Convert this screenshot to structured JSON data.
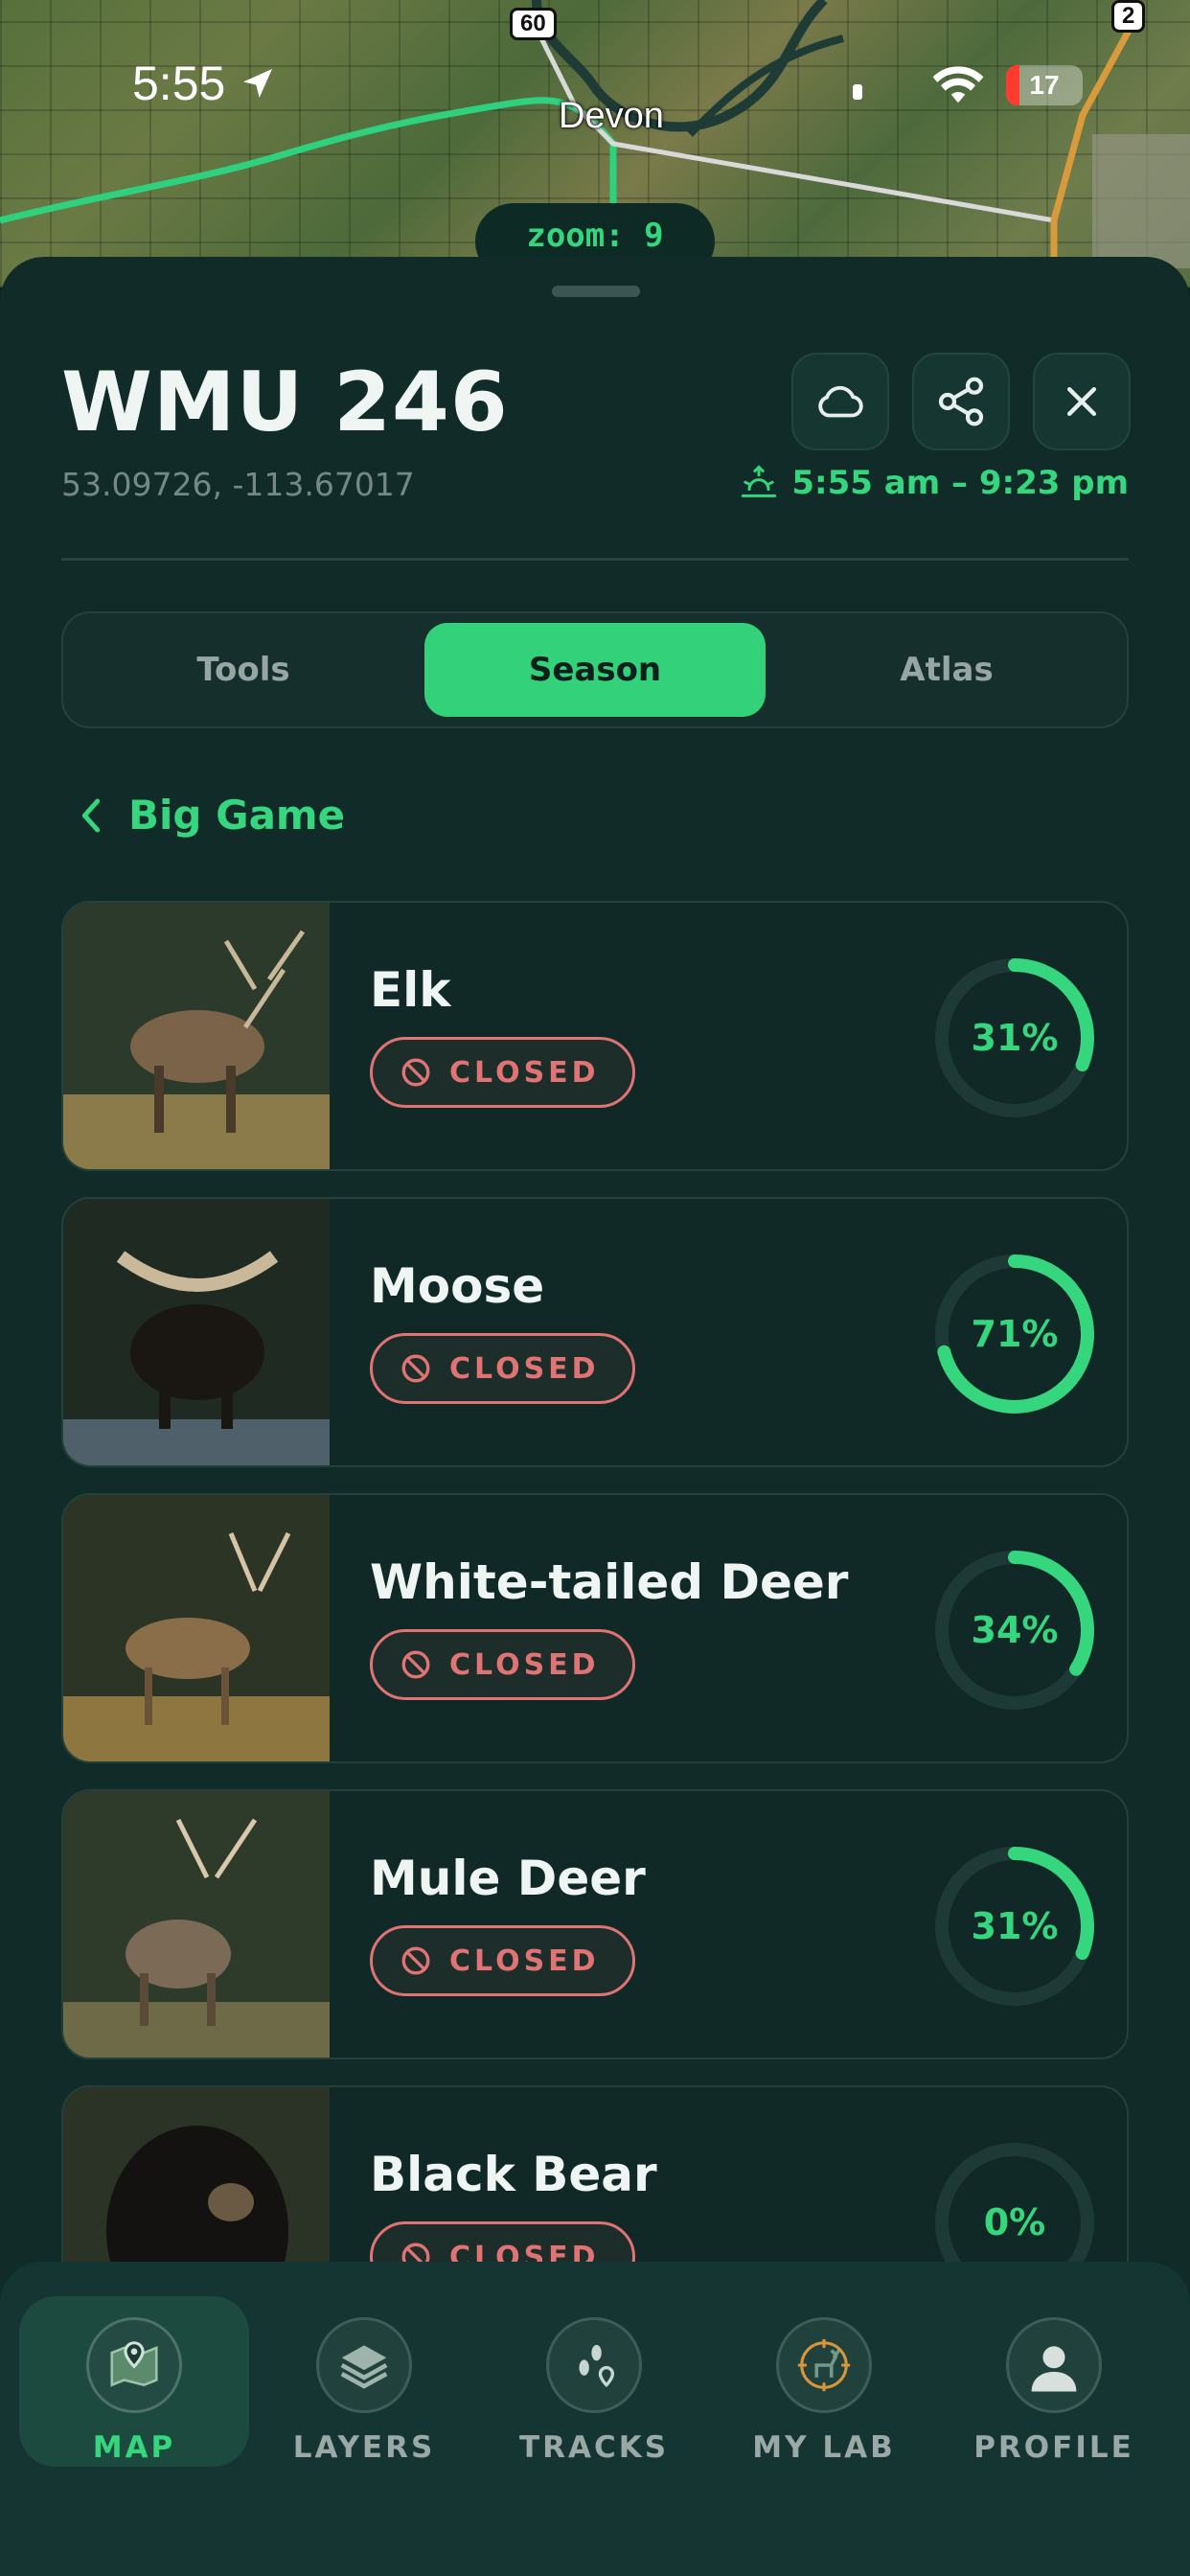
{
  "status_bar": {
    "time": "5:55",
    "battery": "17"
  },
  "map": {
    "town": "Devon",
    "route_badges": [
      "60",
      "2"
    ],
    "zoom_label": "zoom: 9"
  },
  "header": {
    "title": "WMU 246",
    "coordinates": "53.09726, -113.67017",
    "sun_times": "5:55 am – 9:23 pm",
    "icons": [
      "cloud-icon",
      "share-icon",
      "close-icon",
      "sunrise-icon"
    ]
  },
  "tabs": [
    {
      "label": "Tools",
      "active": false
    },
    {
      "label": "Season",
      "active": true
    },
    {
      "label": "Atlas",
      "active": false
    }
  ],
  "breadcrumb": {
    "label": "Big Game"
  },
  "species": [
    {
      "name": "Elk",
      "status": "CLOSED",
      "percent_label": "31%",
      "progress": 0.31
    },
    {
      "name": "Moose",
      "status": "CLOSED",
      "percent_label": "71%",
      "progress": 0.71
    },
    {
      "name": "White-tailed Deer",
      "status": "CLOSED",
      "percent_label": "34%",
      "progress": 0.34
    },
    {
      "name": "Mule Deer",
      "status": "CLOSED",
      "percent_label": "31%",
      "progress": 0.31
    },
    {
      "name": "Black Bear",
      "status": "CLOSED",
      "percent_label": "0%",
      "progress": 0.0
    }
  ],
  "nav": [
    {
      "label": "MAP",
      "icon": "map-pin-icon",
      "active": true
    },
    {
      "label": "LAYERS",
      "icon": "layers-icon",
      "active": false
    },
    {
      "label": "TRACKS",
      "icon": "footprints-icon",
      "active": false
    },
    {
      "label": "MY LAB",
      "icon": "deer-crosshair-icon",
      "active": false
    },
    {
      "label": "PROFILE",
      "icon": "person-icon",
      "active": false
    }
  ],
  "colors": {
    "accent": "#35d67e",
    "closed": "#e07373",
    "background": "#112b28"
  }
}
